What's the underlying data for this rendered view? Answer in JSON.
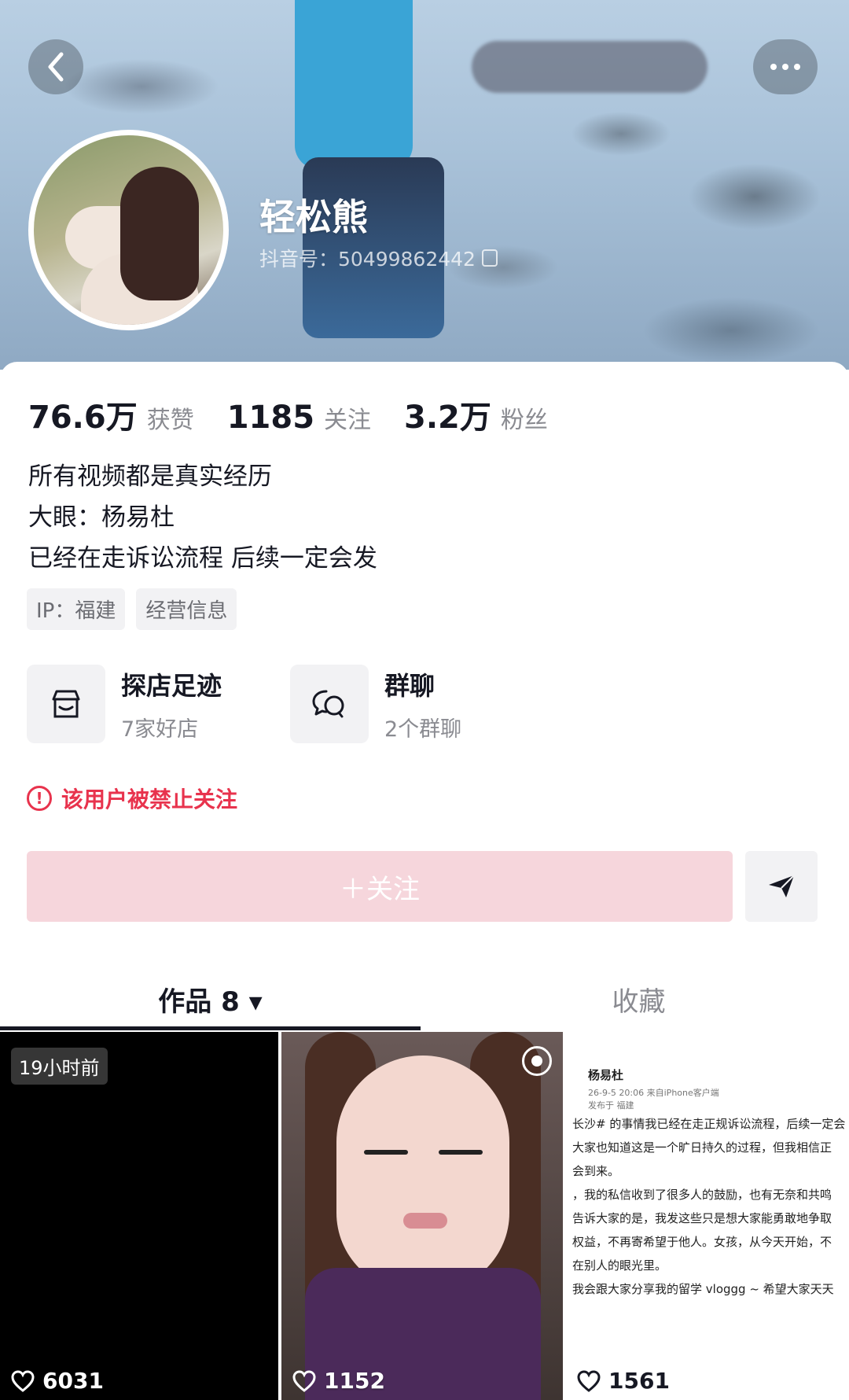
{
  "header": {
    "back_icon": "chevron-left-icon",
    "more_icon": "more-dots-icon"
  },
  "profile": {
    "name": "轻松熊",
    "douyin_id": "抖音号：50499862442",
    "copy_icon": "copy-icon"
  },
  "stats": [
    {
      "num": "76.6万",
      "label": "获赞"
    },
    {
      "num": "1185",
      "label": "关注"
    },
    {
      "num": "3.2万",
      "label": "粉丝"
    }
  ],
  "bio": {
    "line1": "所有视频都是真实经历",
    "line2": "大眼：杨易杜",
    "line3": "已经在走诉讼流程 后续一定会发"
  },
  "tags": {
    "ip": "IP：福建",
    "business": "经营信息"
  },
  "features": [
    {
      "icon": "shop-icon",
      "title": "探店足迹",
      "sub": "7家好店"
    },
    {
      "icon": "group-chat-icon",
      "title": "群聊",
      "sub": "2个群聊"
    }
  ],
  "warning": {
    "text": "该用户被禁止关注"
  },
  "actions": {
    "follow_label": "＋关注",
    "share_icon": "send-icon"
  },
  "tabs": {
    "works": "作品 8 ▾",
    "favorites": "收藏"
  },
  "grid": [
    {
      "badge": "19小时前",
      "likes": "6031"
    },
    {
      "likes": "1152"
    },
    {
      "likes": "1561",
      "post": {
        "author": "杨易杜",
        "meta": "26-9-5 20:06 来自iPhone客户端",
        "location": "发布于 福建",
        "lines": [
          "长沙# 的事情我已经在走正规诉讼流程，后续一定会",
          "大家也知道这是一个旷日持久的过程，但我相信正",
          "会到来。",
          "，我的私信收到了很多人的鼓励，也有无奈和共鸣",
          "告诉大家的是，我发这些只是想大家能勇敢地争取",
          "权益，不再寄希望于他人。女孩，从今天开始，不",
          "在别人的眼光里。",
          "我会跟大家分享我的留学 vloggg ~ 希望大家天天"
        ]
      }
    }
  ],
  "colors": {
    "warning": "#e8334d",
    "follow_disabled": "#f6d6dc",
    "text_primary": "#161823",
    "text_secondary": "#8a8b91"
  }
}
